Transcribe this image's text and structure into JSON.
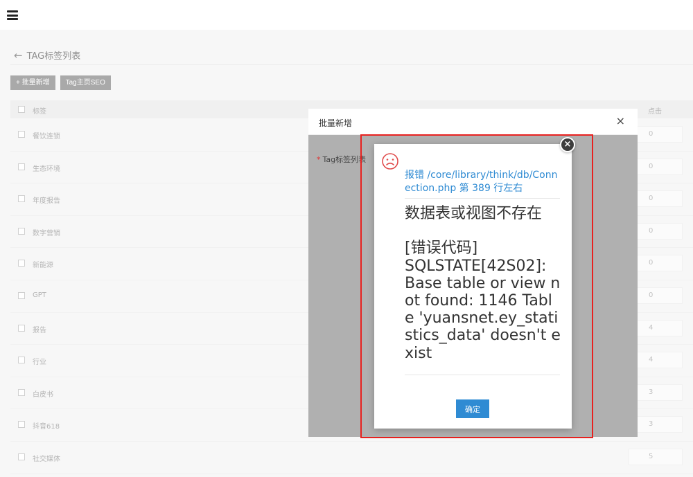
{
  "topbar": {
    "menu_icon": "hamburger-menu-icon"
  },
  "header": {
    "back_icon": "arrow-left-icon",
    "title": "TAG标签列表"
  },
  "toolbar": {
    "batch_add_label": "+ 批量新增",
    "seo_label": "Tag主页SEO"
  },
  "table": {
    "col_tag": "标签",
    "col_clicks": "点击",
    "rows": [
      {
        "name": "餐饮连锁",
        "clicks": "0"
      },
      {
        "name": "生态环境",
        "clicks": "0"
      },
      {
        "name": "年度报告",
        "clicks": "0"
      },
      {
        "name": "数字营销",
        "clicks": "0"
      },
      {
        "name": "新能源",
        "clicks": "0"
      },
      {
        "name": "GPT",
        "clicks": "0"
      },
      {
        "name": "报告",
        "clicks": "4"
      },
      {
        "name": "行业",
        "clicks": "4"
      },
      {
        "name": "白皮书",
        "clicks": "3"
      },
      {
        "name": "抖音618",
        "clicks": "3"
      },
      {
        "name": "社交媒体",
        "clicks": "5"
      }
    ]
  },
  "dialog": {
    "title": "批量新增",
    "close": "×",
    "field_label": "Tag标签列表",
    "required_mark": "*"
  },
  "alert": {
    "icon": "sad-face-icon",
    "title": "报错 /core/library/think/db/Connection.php 第 389 行左右",
    "message": "数据表或视图不存在\n\n[错误代码]\nSQLSTATE[42S02]: Base table or view not found: 1146 Table 'yuansnet.ey_statistics_data' doesn't exist",
    "ok_label": "确定",
    "close": "×"
  },
  "colors": {
    "accent": "#2f8bd3",
    "highlight": "#e8211f",
    "error_icon": "#e04a4a"
  }
}
